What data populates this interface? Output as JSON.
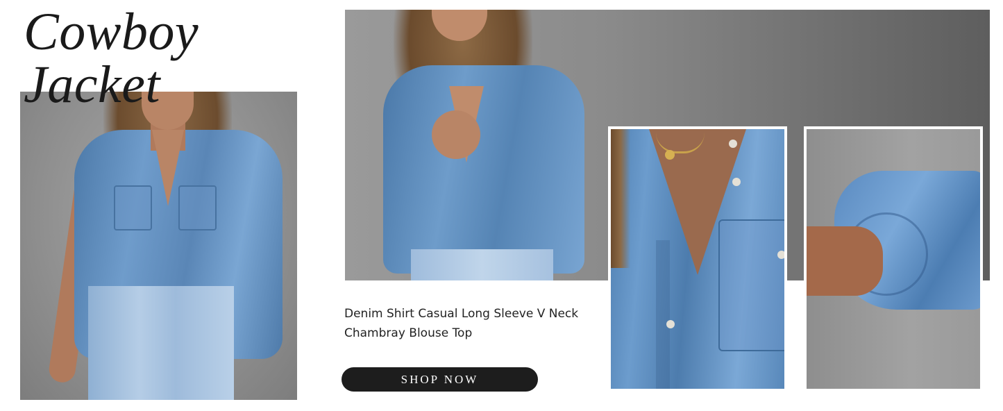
{
  "banner": {
    "title_line1": "Cowboy",
    "title_line2": "Jacket",
    "description_line1": "Denim Shirt Casual Long Sleeve V Neck",
    "description_line2": "Chambray Blouse Top",
    "cta_label": "SHOP NOW"
  },
  "colors": {
    "denim": "#6e9cca",
    "background": "#8f8f8f",
    "button": "#1d1d1d",
    "title": "#1a1a1a"
  }
}
